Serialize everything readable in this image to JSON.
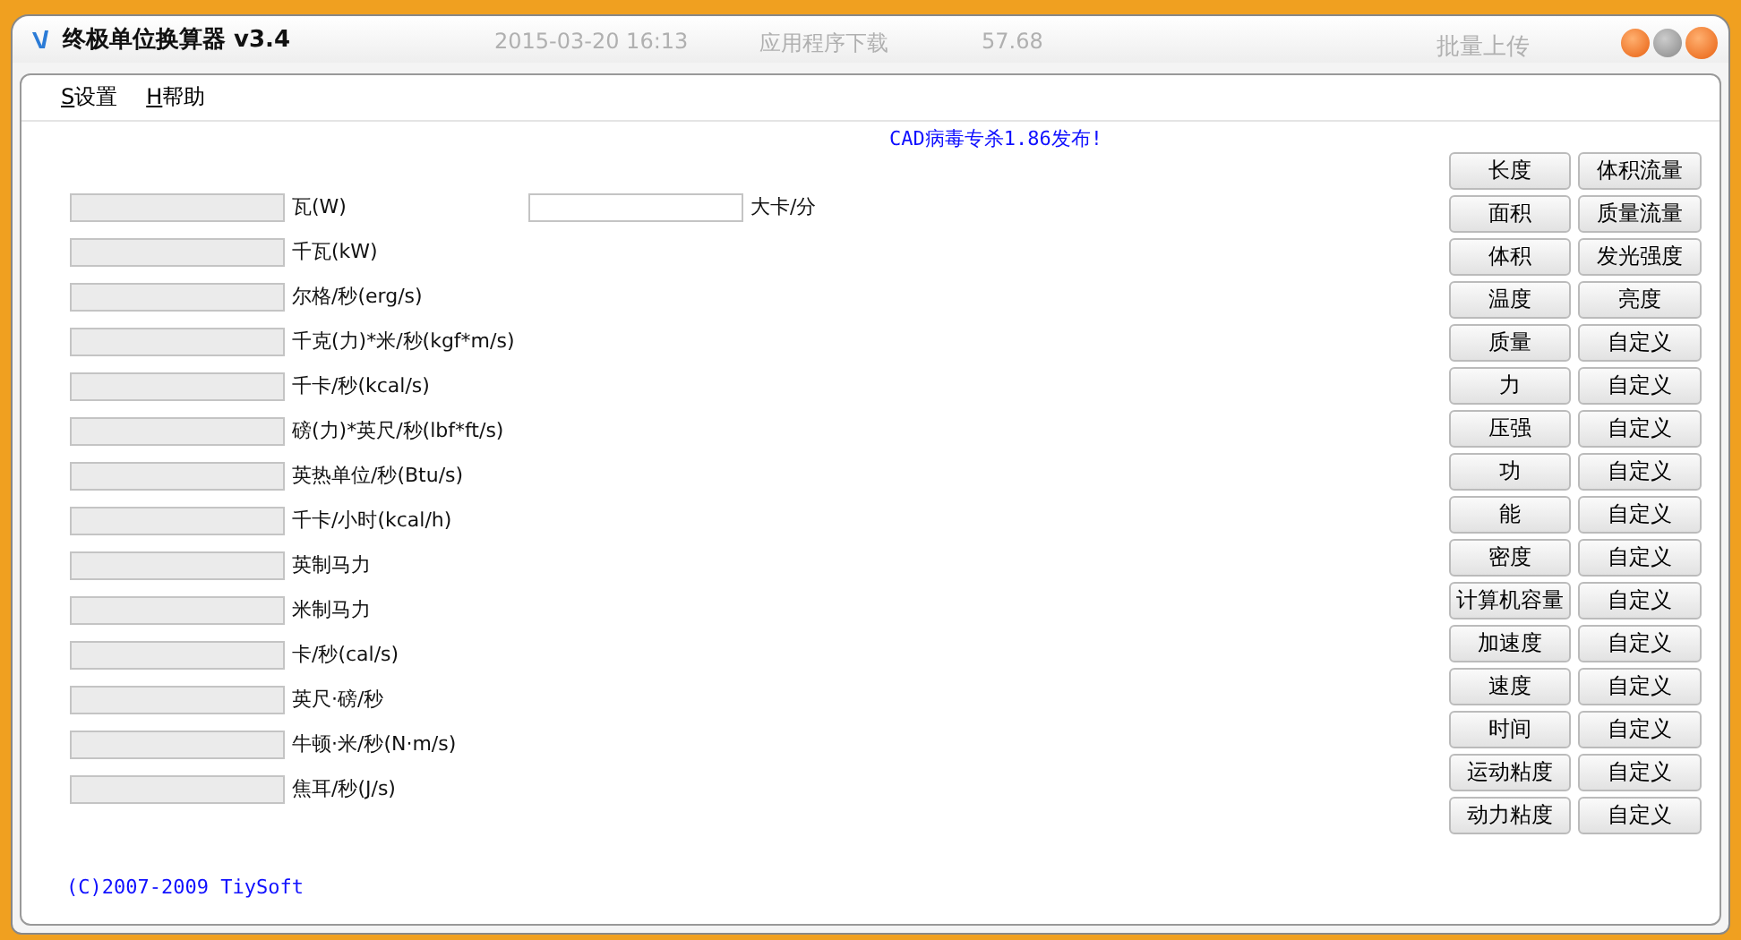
{
  "window": {
    "title": "终极单位换算器 v3.4"
  },
  "background_texts": [
    "2015-03-20 16:13",
    "应用程序下载",
    "57.68",
    "批量上传"
  ],
  "menu": [
    {
      "key": "S",
      "label": "设置"
    },
    {
      "key": "H",
      "label": "帮助"
    }
  ],
  "announcement": "CAD病毒专杀1.86发布!",
  "units": [
    {
      "label": "瓦(W)"
    },
    {
      "label": "千瓦(kW)"
    },
    {
      "label": "尔格/秒(erg/s)"
    },
    {
      "label": "千克(力)*米/秒(kgf*m/s)"
    },
    {
      "label": "千卡/秒(kcal/s)"
    },
    {
      "label": "磅(力)*英尺/秒(lbf*ft/s)"
    },
    {
      "label": "英热单位/秒(Btu/s)"
    },
    {
      "label": "千卡/小时(kcal/h)"
    },
    {
      "label": "英制马力"
    },
    {
      "label": "米制马力"
    },
    {
      "label": "卡/秒(cal/s)"
    },
    {
      "label": "英尺·磅/秒"
    },
    {
      "label": "牛顿·米/秒(N·m/s)"
    },
    {
      "label": "焦耳/秒(J/s)"
    }
  ],
  "extra_unit": {
    "label": "大卡/分"
  },
  "categories_left": [
    "长度",
    "面积",
    "体积",
    "温度",
    "质量",
    "力",
    "压强",
    "功",
    "能",
    "密度",
    "计算机容量",
    "加速度",
    "速度",
    "时间",
    "运动粘度",
    "动力粘度"
  ],
  "categories_right": [
    "体积流量",
    "质量流量",
    "发光强度",
    "亮度",
    "自定义",
    "自定义",
    "自定义",
    "自定义",
    "自定义",
    "自定义",
    "自定义",
    "自定义",
    "自定义",
    "自定义",
    "自定义",
    "自定义"
  ],
  "copyright": "(C)2007-2009 TiySoft"
}
